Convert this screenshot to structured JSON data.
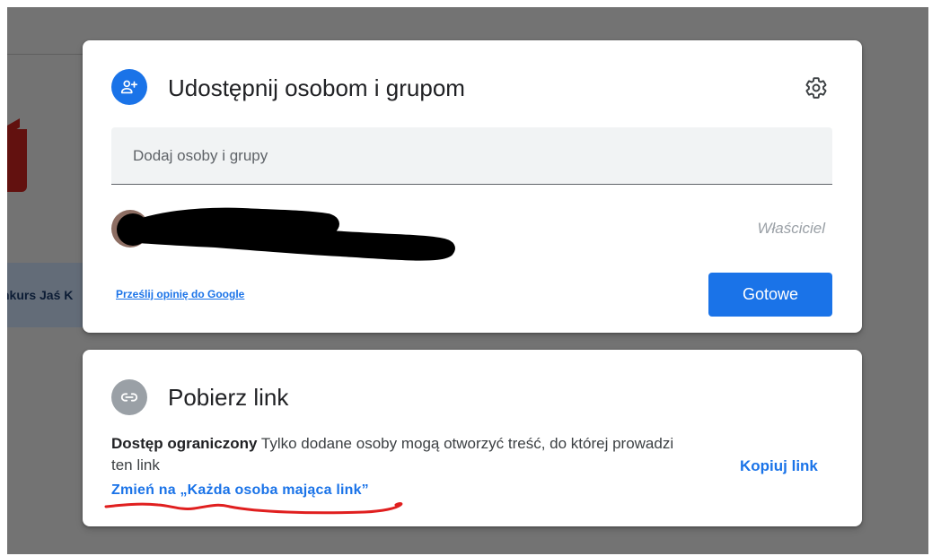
{
  "background": {
    "tab_label": "nkurs Jaś K",
    "scrim_color": "#808080"
  },
  "share_dialog": {
    "icon": "person-add-icon",
    "title": "Udostępnij osobom i grupom",
    "settings_icon": "gear-icon",
    "add_people": {
      "placeholder": "Dodaj osoby i grupy",
      "value": ""
    },
    "owner": {
      "role": "Właściciel"
    },
    "feedback_link": "Prześlij opinię do Google",
    "done_button": "Gotowe"
  },
  "link_dialog": {
    "icon": "link-icon",
    "title": "Pobierz link",
    "access_label": "Dostęp ograniczony",
    "access_description": " Tylko dodane osoby mogą otworzyć treść, do której prowadzi ten link",
    "change_link": "Zmień na „Każda osoba mająca link”",
    "copy_link": "Kopiuj link"
  },
  "colors": {
    "accent": "#1a73e8",
    "link_icon_bg": "#9aa0a6",
    "annotation_red": "#e01f1f"
  }
}
